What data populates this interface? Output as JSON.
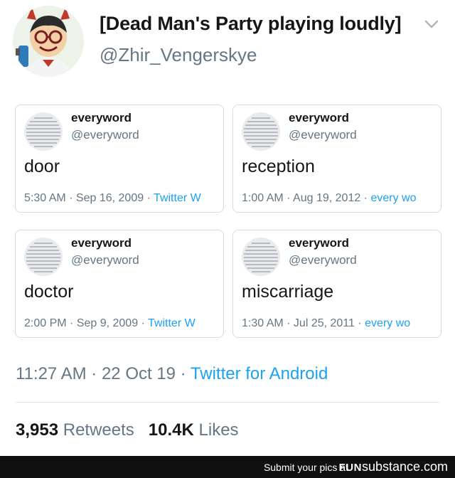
{
  "tweet": {
    "display_name": "[Dead Man's Party playing loudly]",
    "handle": "@Zhir_Vengerskye",
    "timestamp": "11:27 AM · 22 Oct 19 · ",
    "source": "Twitter for Android",
    "retweets_count": "3,953",
    "retweets_label": "Retweets",
    "likes_count": "10.4K",
    "likes_label": "Likes"
  },
  "quoted": [
    {
      "name": "everyword",
      "handle": "@everyword",
      "word": "door",
      "date": "5:30 AM · Sep 16, 2009 · ",
      "source": "Twitter W"
    },
    {
      "name": "everyword",
      "handle": "@everyword",
      "word": "reception",
      "date": "1:00 AM · Aug 19, 2012 · ",
      "source": "every wo"
    },
    {
      "name": "everyword",
      "handle": "@everyword",
      "word": "doctor",
      "date": "2:00 PM · Sep 9, 2009 · ",
      "source": "Twitter W"
    },
    {
      "name": "everyword",
      "handle": "@everyword",
      "word": "miscarriage",
      "date": "1:30 AM · Jul 25, 2011 · ",
      "source": "every wo"
    }
  ],
  "footer": {
    "submit_text": "Submit your pics at",
    "brand_fun": "FUN",
    "brand_rest": "substance.com"
  }
}
